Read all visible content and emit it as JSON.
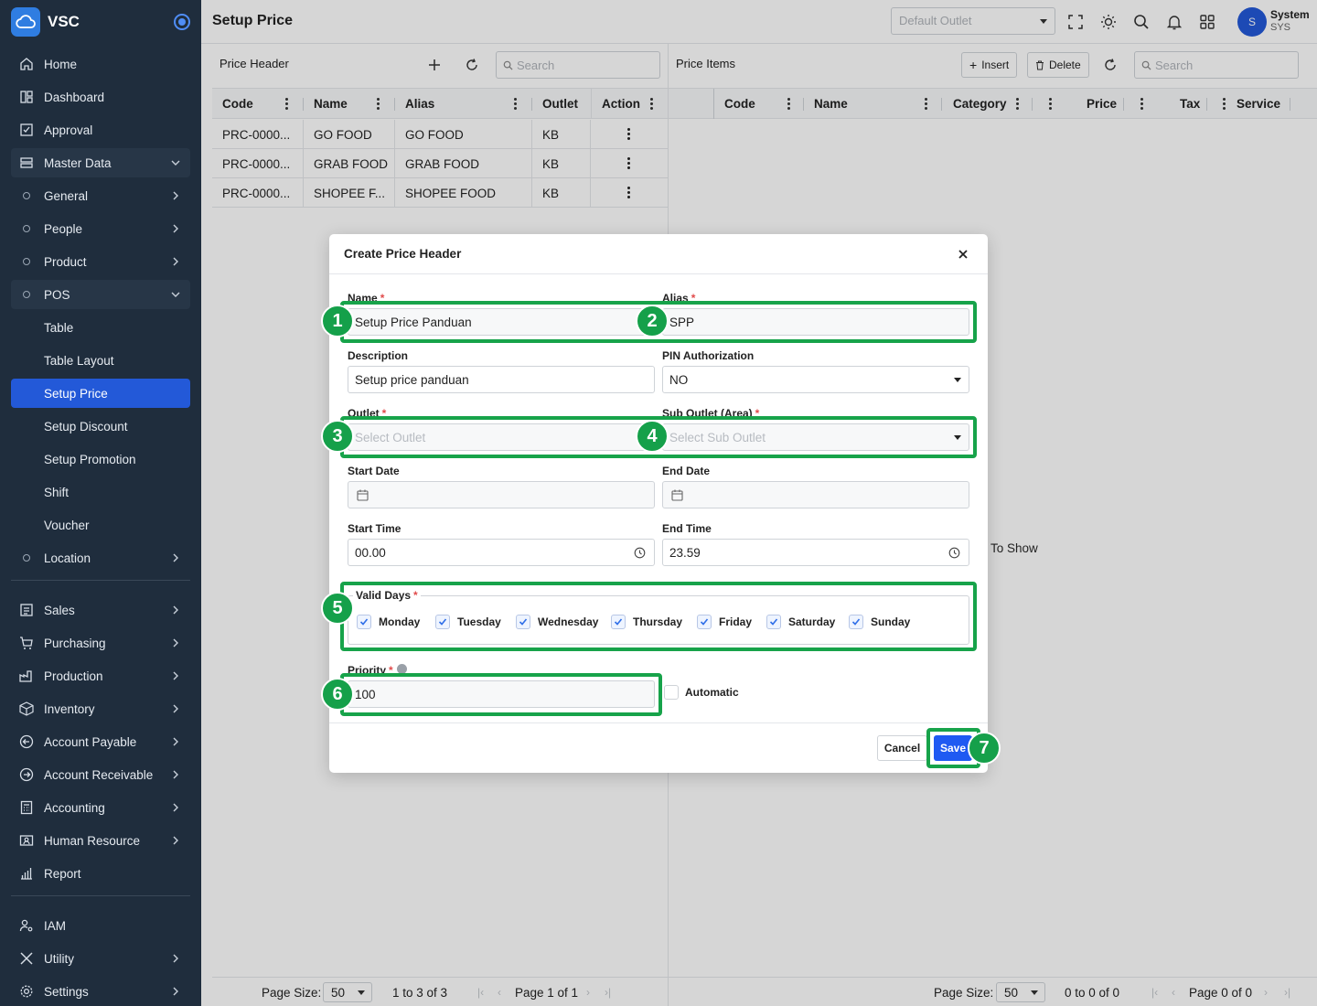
{
  "app": {
    "brand": "VSC"
  },
  "sidebar": {
    "items": [
      {
        "label": "Home"
      },
      {
        "label": "Dashboard"
      },
      {
        "label": "Approval"
      },
      {
        "label": "Master Data"
      },
      {
        "label": "General"
      },
      {
        "label": "People"
      },
      {
        "label": "Product"
      },
      {
        "label": "POS"
      },
      {
        "label": "Table"
      },
      {
        "label": "Table Layout"
      },
      {
        "label": "Setup Price"
      },
      {
        "label": "Setup Discount"
      },
      {
        "label": "Setup Promotion"
      },
      {
        "label": "Shift"
      },
      {
        "label": "Voucher"
      },
      {
        "label": "Location"
      },
      {
        "label": "Sales"
      },
      {
        "label": "Purchasing"
      },
      {
        "label": "Production"
      },
      {
        "label": "Inventory"
      },
      {
        "label": "Account Payable"
      },
      {
        "label": "Account Receivable"
      },
      {
        "label": "Accounting"
      },
      {
        "label": "Human Resource"
      },
      {
        "label": "Report"
      },
      {
        "label": "IAM"
      },
      {
        "label": "Utility"
      },
      {
        "label": "Settings"
      }
    ]
  },
  "header": {
    "title": "Setup Price",
    "outlet_placeholder": "Default Outlet",
    "user": {
      "initial": "S",
      "name": "System",
      "code": "SYS"
    }
  },
  "price_header": {
    "title": "Price Header",
    "search_placeholder": "Search",
    "columns": [
      "Code",
      "Name",
      "Alias",
      "Outlet",
      "Action"
    ],
    "rows": [
      {
        "code": "PRC-0000...",
        "name": "GO FOOD",
        "alias": "GO FOOD",
        "outlet": "KB"
      },
      {
        "code": "PRC-0000...",
        "name": "GRAB FOOD",
        "alias": "GRAB FOOD",
        "outlet": "KB"
      },
      {
        "code": "PRC-0000...",
        "name": "SHOPEE F...",
        "alias": "SHOPEE FOOD",
        "outlet": "KB"
      }
    ],
    "footer": {
      "page_size_label": "Page Size:",
      "page_size": "50",
      "range": "1 to 3 of 3",
      "page": "Page 1 of 1"
    }
  },
  "price_items": {
    "title": "Price Items",
    "insert_label": "Insert",
    "delete_label": "Delete",
    "search_placeholder": "Search",
    "columns": [
      "Code",
      "Name",
      "Category",
      "Price",
      "Tax",
      "Service"
    ],
    "empty_text": "To Show",
    "footer": {
      "page_size_label": "Page Size:",
      "page_size": "50",
      "range": "0 to 0 of 0",
      "page": "Page 0 of 0"
    }
  },
  "modal": {
    "title": "Create Price Header",
    "name_label": "Name",
    "name_value": "Setup Price Panduan",
    "alias_label": "Alias",
    "alias_value": "SPP",
    "description_label": "Description",
    "description_value": "Setup price panduan",
    "pin_label": "PIN Authorization",
    "pin_value": "NO",
    "outlet_label": "Outlet",
    "outlet_placeholder": "Select Outlet",
    "sub_outlet_label": "Sub Outlet (Area)",
    "sub_outlet_placeholder": "Select Sub Outlet",
    "start_date_label": "Start Date",
    "end_date_label": "End Date",
    "start_time_label": "Start Time",
    "start_time_value": "00.00",
    "end_time_label": "End Time",
    "end_time_value": "23.59",
    "valid_days_label": "Valid Days",
    "days": [
      "Monday",
      "Tuesday",
      "Wednesday",
      "Thursday",
      "Friday",
      "Saturday",
      "Sunday"
    ],
    "priority_label": "Priority",
    "priority_value": "100",
    "automatic_label": "Automatic",
    "cancel_label": "Cancel",
    "save_label": "Save"
  },
  "annotations": [
    "1",
    "2",
    "3",
    "4",
    "5",
    "6",
    "7"
  ],
  "colors": {
    "sidebar": "#1f2d3d",
    "active": "#2359d8",
    "highlight": "#17a34a",
    "save": "#1f5af2"
  }
}
